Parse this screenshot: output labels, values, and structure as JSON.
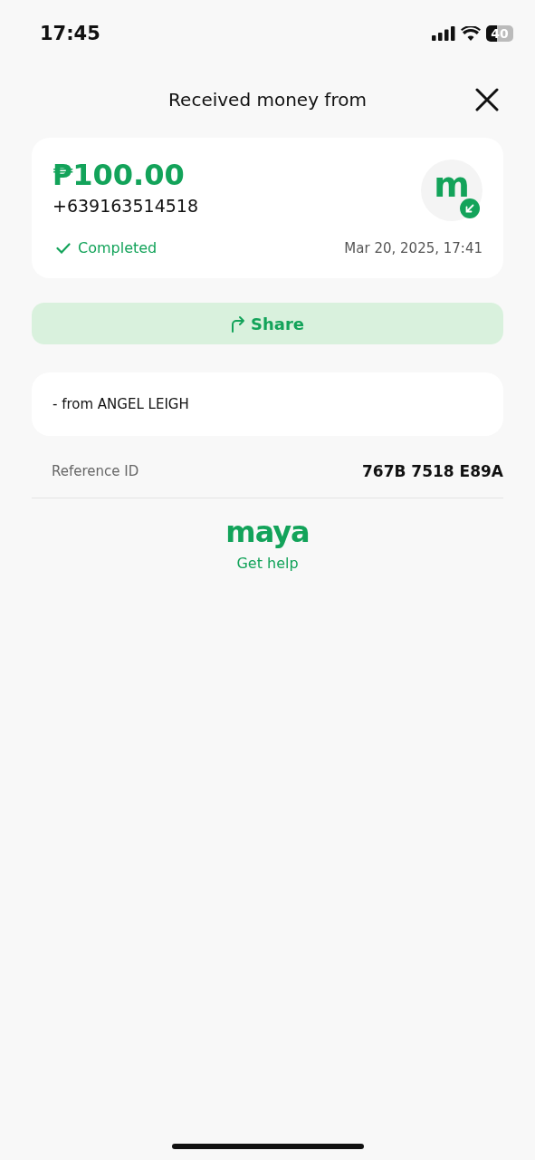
{
  "status_bar": {
    "time": "17:45",
    "battery": "40"
  },
  "header": {
    "title": "Received money from"
  },
  "summary": {
    "amount": "₱100.00",
    "phone": "+639163514518",
    "avatar_letter": "m",
    "status": {
      "label": "Completed",
      "kind": "completed"
    },
    "datetime": "Mar 20, 2025, 17:41"
  },
  "share_button": {
    "label": "Share"
  },
  "note": "- from ANGEL LEIGH",
  "reference": {
    "label": "Reference ID",
    "value": "767B 7518 E89A"
  },
  "footer": {
    "logo": "maya",
    "help_link": "Get help"
  }
}
